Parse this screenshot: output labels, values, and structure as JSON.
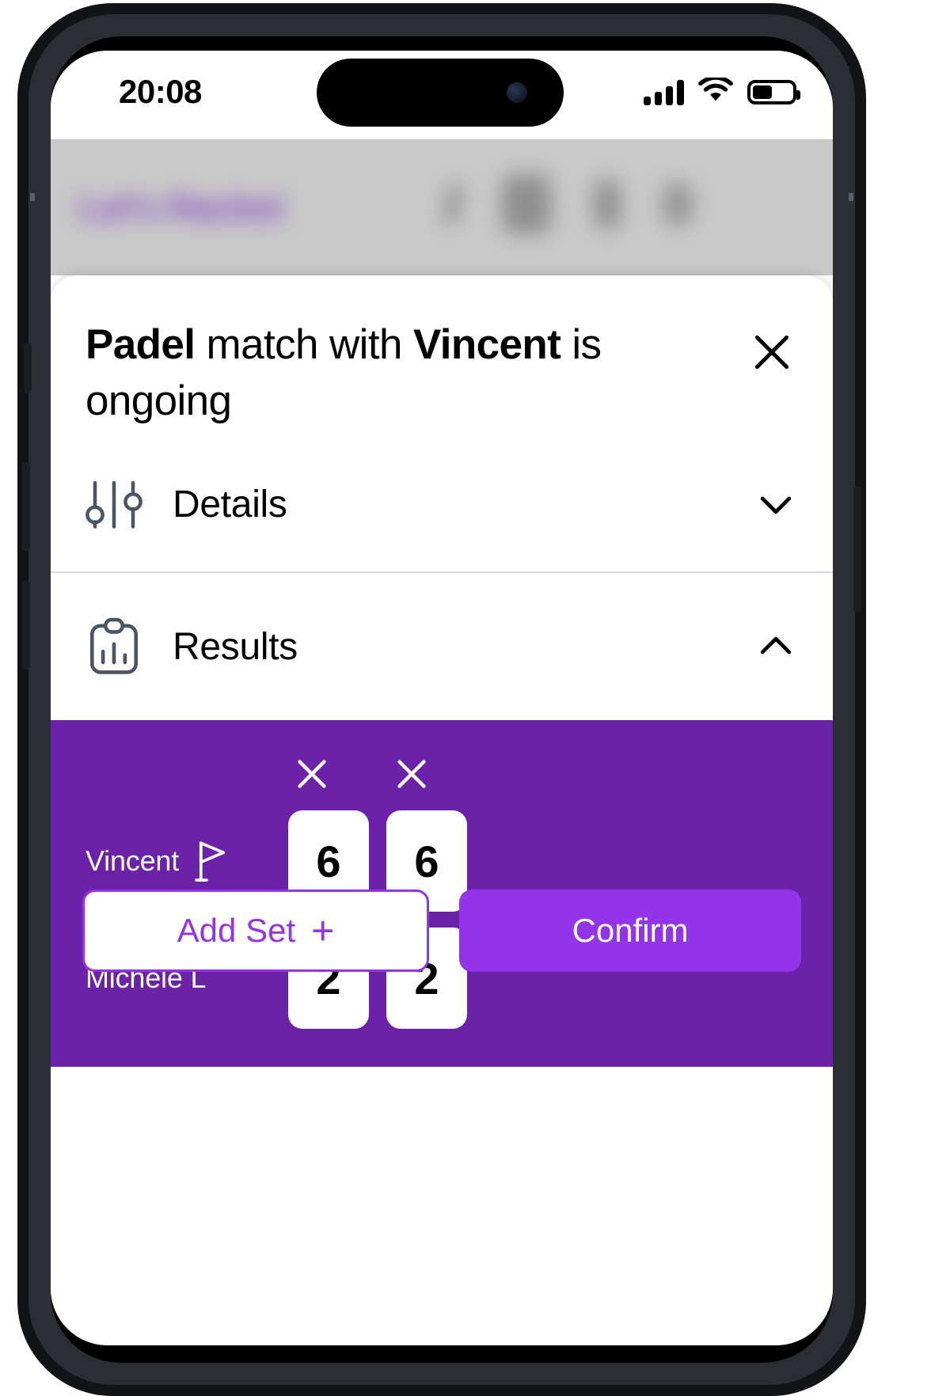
{
  "status_bar": {
    "time": "20:08",
    "cellular_icon": "cellular-bars-icon",
    "wifi_icon": "wifi-icon",
    "battery_icon": "battery-icon",
    "battery_level_percent": 45
  },
  "background_app": {
    "logo_text": "Let's Racket",
    "logo_color": "#8a4fc4",
    "icons": [
      "call-icon",
      "calendar-icon",
      "book-icon",
      "profile-icon"
    ]
  },
  "modal": {
    "title_prefix": "Padel",
    "title_middle": " match with ",
    "title_name": "Vincent",
    "title_suffix": " is ongoing",
    "close_icon": "close-icon",
    "sections": [
      {
        "label": "Details",
        "icon": "sliders-icon",
        "chevron": "chevron-down-icon",
        "expanded": false
      },
      {
        "label": "Results",
        "icon": "clipboard-chart-icon",
        "chevron": "chevron-up-icon",
        "expanded": true
      }
    ]
  },
  "scoreboard": {
    "panel_color": "#6b21a8",
    "remove_set_icon": "close-icon",
    "sets_count": 2,
    "rows": [
      {
        "player": "Vincent",
        "serving": true,
        "serve_icon": "flag-icon",
        "scores": [
          "6",
          "6"
        ]
      },
      {
        "player": "Michele L",
        "serving": false,
        "serve_icon": "flag-icon",
        "scores": [
          "2",
          "2"
        ]
      }
    ]
  },
  "actions": {
    "add_set_label": "Add Set",
    "add_set_plus": "+",
    "add_set_color": "#9333ea",
    "confirm_label": "Confirm",
    "confirm_color": "#9333ea"
  }
}
